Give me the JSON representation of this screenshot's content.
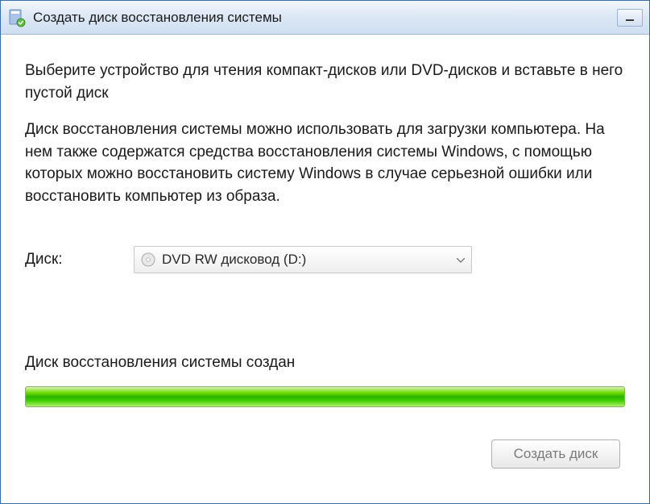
{
  "titlebar": {
    "title": "Создать диск восстановления системы"
  },
  "content": {
    "heading": "Выберите устройство для чтения компакт-дисков или DVD-дисков и вставьте в него пустой диск",
    "description": "Диск восстановления системы можно использовать для загрузки компьютера. На нем также содержатся средства восстановления системы Windows, с помощью которых можно восстановить систему Windows в случае серьезной ошибки или восстановить компьютер из образа.",
    "drive_label": "Диск:",
    "drive_selected": "DVD RW дисковод (D:)",
    "status_text": "Диск восстановления системы создан",
    "progress_percent": 100
  },
  "buttons": {
    "create": "Создать диск"
  }
}
